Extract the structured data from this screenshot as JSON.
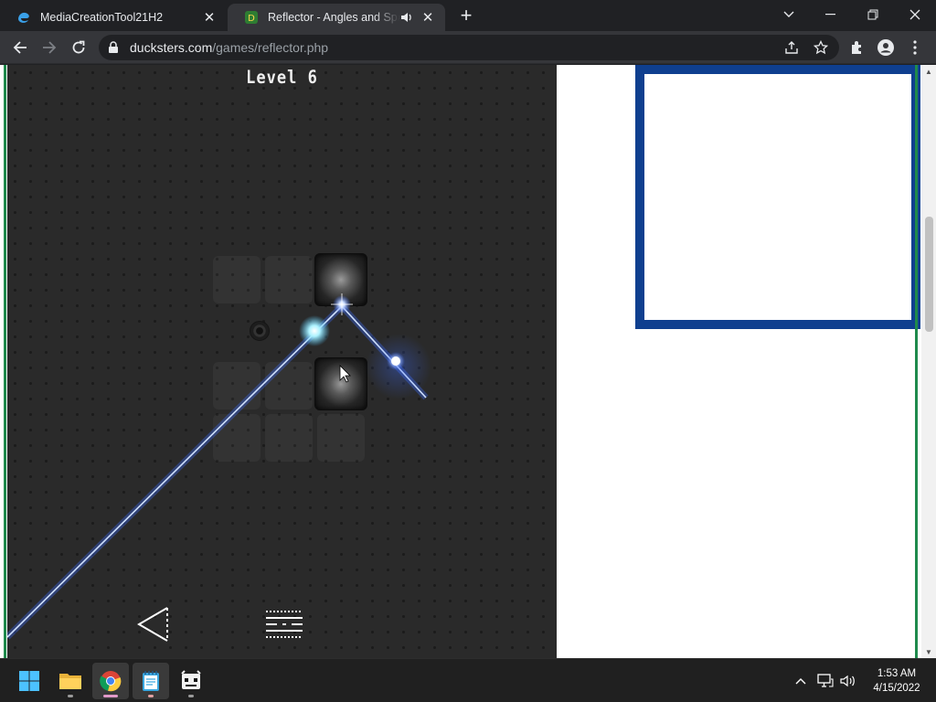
{
  "browser": {
    "tabs": [
      {
        "title": "MediaCreationTool21H2",
        "active": false,
        "favicon": "edge-icon"
      },
      {
        "title": "Reflector - Angles and Spacing",
        "active": true,
        "favicon": "ducksters-icon",
        "audio": true
      }
    ],
    "url": {
      "host": "ducksters.com",
      "path": "/games/reflector.php"
    }
  },
  "game": {
    "level_label": "Level 6"
  },
  "colors": {
    "beam": "#6ea8ff",
    "ad_border": "#0f3f8f",
    "page_accent": "#1f8a4c"
  },
  "taskbar": {
    "apps": [
      "start-icon",
      "file-explorer-icon",
      "chrome-icon",
      "notepad-icon",
      "game-app-icon"
    ],
    "clock": {
      "time": "1:53 AM",
      "date": "4/15/2022"
    }
  }
}
